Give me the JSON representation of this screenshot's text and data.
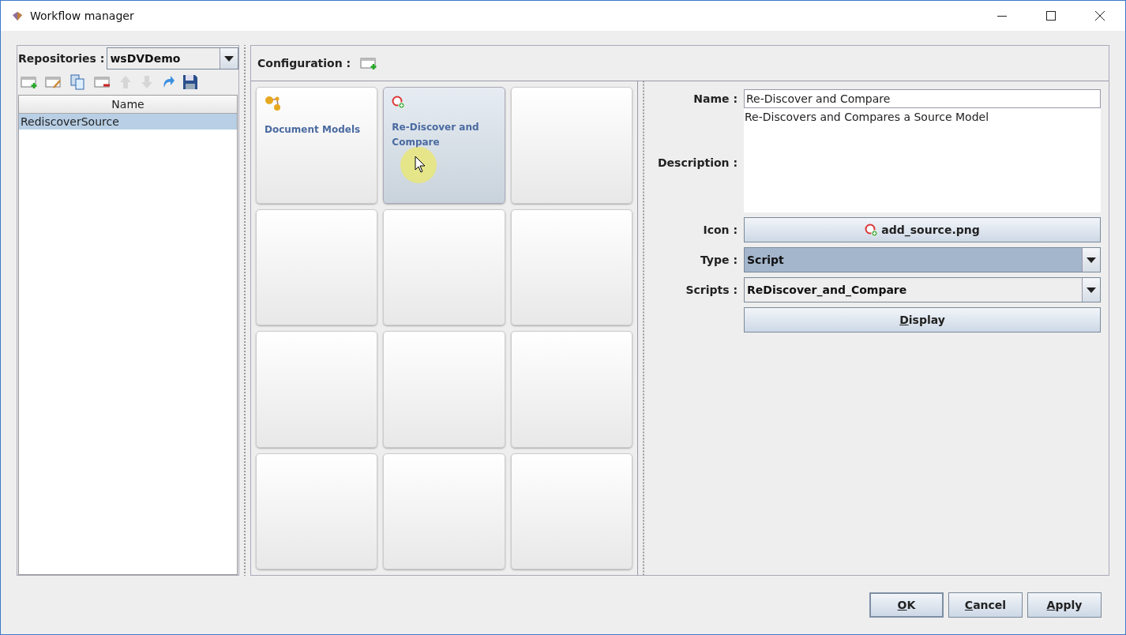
{
  "window": {
    "title": "Workflow manager"
  },
  "repositories": {
    "label": "Repositories :",
    "value": "wsDVDemo"
  },
  "repo_toolbar": [
    {
      "kind": "add",
      "disabled": false
    },
    {
      "kind": "edit",
      "disabled": false
    },
    {
      "kind": "copy",
      "disabled": false
    },
    {
      "kind": "remove",
      "disabled": false
    },
    {
      "kind": "up",
      "disabled": true
    },
    {
      "kind": "down",
      "disabled": true
    },
    {
      "kind": "refresh",
      "disabled": false
    },
    {
      "kind": "save",
      "disabled": false
    }
  ],
  "workflow_table": {
    "columns": [
      "Name"
    ],
    "rows": [
      {
        "name": "RediscoverSource",
        "selected": true
      }
    ]
  },
  "configuration": {
    "label": "Configuration :"
  },
  "tiles": [
    {
      "kind": "action",
      "label": "Document Models",
      "selected": false
    },
    {
      "kind": "action",
      "label": "Re-Discover and Compare",
      "selected": true
    },
    {
      "kind": "empty",
      "selected": false
    },
    {
      "kind": "empty",
      "selected": false
    },
    {
      "kind": "empty",
      "selected": false
    },
    {
      "kind": "empty",
      "selected": false
    },
    {
      "kind": "empty",
      "selected": false
    },
    {
      "kind": "empty",
      "selected": false
    },
    {
      "kind": "empty",
      "selected": false
    },
    {
      "kind": "empty",
      "selected": false
    },
    {
      "kind": "empty",
      "selected": false
    },
    {
      "kind": "empty",
      "selected": false
    }
  ],
  "form": {
    "name_label": "Name :",
    "name": "Re-Discover and Compare",
    "description_label": "Description :",
    "description": "Re-Discovers and Compares a Source Model",
    "icon_label": "Icon :",
    "icon_file": "add_source.png",
    "type_label": "Type :",
    "type": "Script",
    "scripts_label": "Scripts :",
    "script": "ReDiscover_and_Compare",
    "display_button": {
      "label": "Display",
      "mnemonic": true
    }
  },
  "buttons": [
    {
      "label": "OK",
      "mnemonic": true,
      "default": true
    },
    {
      "label": "Cancel",
      "mnemonic": true,
      "default": false
    },
    {
      "label": "Apply",
      "mnemonic": true,
      "default": false
    }
  ]
}
